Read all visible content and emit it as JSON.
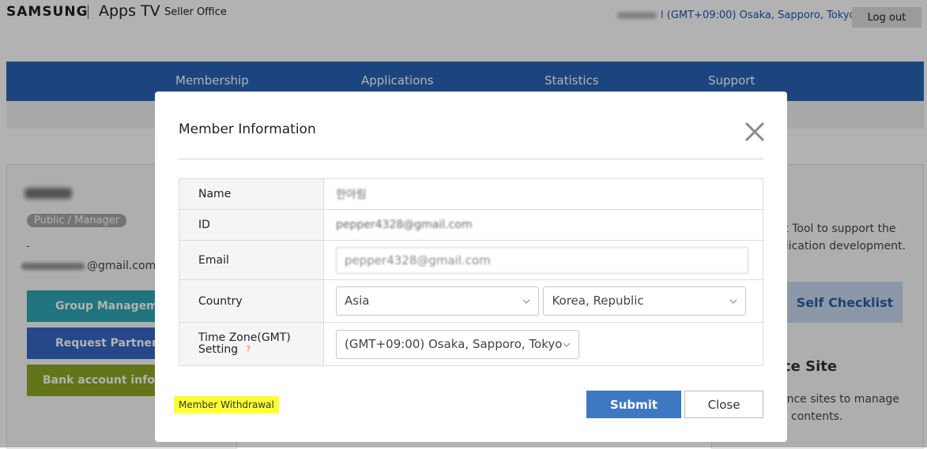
{
  "header": {
    "brand": "SAMSUNG",
    "product": "Apps TV",
    "subtitle": "Seller Office",
    "timezone_link": "l (GMT+09:00) Osaka, Sapporo, Tokyo",
    "logout_label": "Log out"
  },
  "nav": {
    "items": [
      "Membership",
      "Applications",
      "Statistics",
      "Support"
    ]
  },
  "left_panel": {
    "role": "Public / Manager",
    "dash": "-",
    "email_suffix": "@gmail.com",
    "buttons": [
      "Group Management",
      "Request Partnership",
      "Bank account informat"
    ]
  },
  "right_panel": {
    "text1_line1": "st Tool to support the",
    "text1_line2": "plication development.",
    "self_checklist": "Self Checklist",
    "site_heading": "ce Site",
    "text2_line1": "ence sites to manage",
    "text2_line2": "contents."
  },
  "modal": {
    "title": "Member Information",
    "rows": {
      "name_label": "Name",
      "name_value": "한아림",
      "id_label": "ID",
      "id_value": "pepper4328@gmail.com",
      "email_label": "Email",
      "email_value": "pepper4328@gmail.com",
      "country_label": "Country",
      "region_value": "Asia",
      "country_value": "Korea, Republic",
      "tz_label_line1": "Time Zone(GMT)",
      "tz_label_line2": "Setting",
      "tz_help": "?",
      "tz_value": "(GMT+09:00) Osaka, Sapporo, Tokyo"
    },
    "withdraw_label": "Member Withdrawal",
    "submit_label": "Submit",
    "close_label": "Close"
  },
  "colors": {
    "nav_blue": "#2963b8",
    "submit_blue": "#3e78c0",
    "highlight_yellow": "#ffff33",
    "group_mgmt": "#2fa6b4",
    "request_partnership": "#3567c7",
    "bank_account": "#8fa824"
  }
}
